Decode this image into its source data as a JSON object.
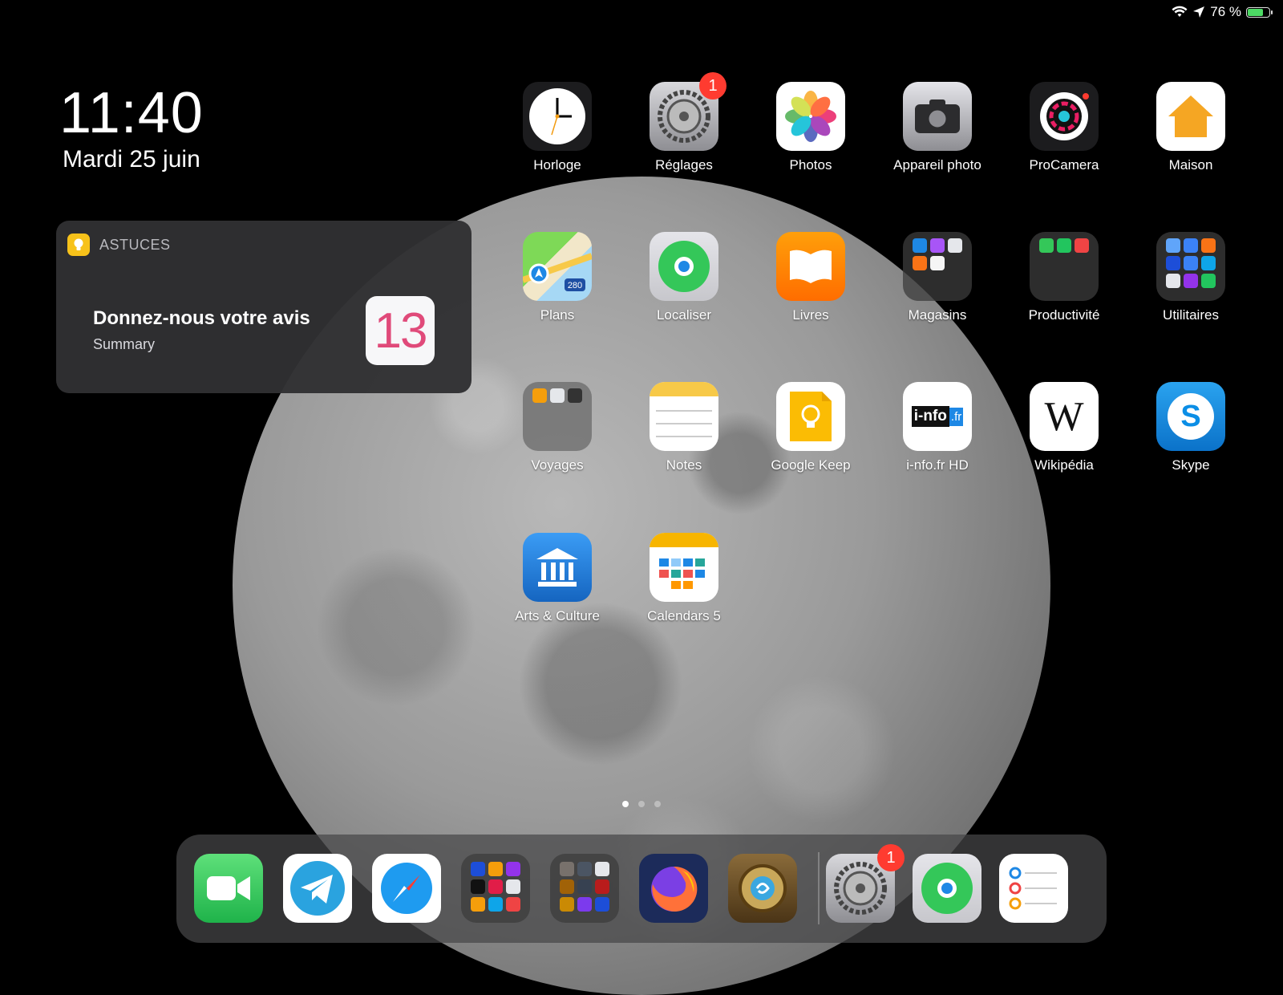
{
  "status": {
    "battery_text": "76 %",
    "battery_level": 0.76
  },
  "clock": {
    "time": "11:40",
    "date": "Mardi 25 juin"
  },
  "widget": {
    "app_name": "ASTUCES",
    "title": "Donnez-nous votre avis",
    "subtitle": "Summary",
    "image_text": "13"
  },
  "apps": {
    "horloge": "Horloge",
    "reglages": "Réglages",
    "reglages_badge": "1",
    "photos": "Photos",
    "appareil": "Appareil photo",
    "procamera": "ProCamera",
    "maison": "Maison",
    "plans": "Plans",
    "plans_shield": "280",
    "localiser": "Localiser",
    "livres": "Livres",
    "magasins": "Magasins",
    "productivite": "Productivité",
    "utilitaires": "Utilitaires",
    "voyages": "Voyages",
    "notes": "Notes",
    "keep": "Google Keep",
    "info": "i-nfo.fr HD",
    "info_logo": "i-nfo",
    "info_logo_fr": ".fr",
    "wiki": "Wikipédia",
    "wiki_logo": "W",
    "skype": "Skype",
    "skype_logo": "S",
    "arts": "Arts & Culture",
    "calendars": "Calendars 5"
  },
  "dock": {
    "settings_badge": "1"
  },
  "colors": {
    "badge": "#ff3b30",
    "facetime": "#34c759",
    "telegram": "#2aa3df",
    "home": "#f5a623"
  }
}
